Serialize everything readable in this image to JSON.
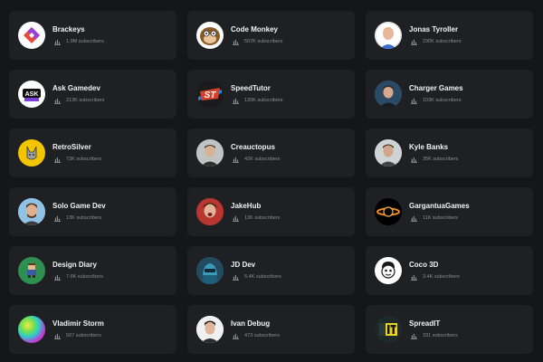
{
  "channels": [
    {
      "name": "Brackeys",
      "subs": "1.9M subscribers",
      "icon": "brackeys-logo-icon",
      "color": "#ffffff"
    },
    {
      "name": "Code Monkey",
      "subs": "597K subscribers",
      "icon": "monkey-avatar-icon",
      "color": "#ffffff"
    },
    {
      "name": "Jonas Tyroller",
      "subs": "230K subscribers",
      "icon": "person-avatar-icon",
      "color": "#ffffff"
    },
    {
      "name": "Ask Gamedev",
      "subs": "213K subscribers",
      "icon": "ask-gamedev-logo-icon",
      "color": "#ffffff"
    },
    {
      "name": "SpeedTutor",
      "subs": "130K subscribers",
      "icon": "speedtutor-logo-icon",
      "color": "#1b1b1b"
    },
    {
      "name": "Charger Games",
      "subs": "103K subscribers",
      "icon": "person-avatar-icon",
      "color": "#3a5a7a"
    },
    {
      "name": "RetroSilver",
      "subs": "73K subscribers",
      "icon": "retrosilver-logo-icon",
      "color": "#f2c500"
    },
    {
      "name": "Creauctopus",
      "subs": "42K subscribers",
      "icon": "person-avatar-icon",
      "color": "#cfcfcf"
    },
    {
      "name": "Kyle Banks",
      "subs": "35K subscribers",
      "icon": "person-avatar-icon",
      "color": "#d8d8d8"
    },
    {
      "name": "Solo Game Dev",
      "subs": "13K subscribers",
      "icon": "person-avatar-icon",
      "color": "#7fb4d9"
    },
    {
      "name": "JakeHub",
      "subs": "13K subscribers",
      "icon": "person-avatar-icon",
      "color": "#c2403a"
    },
    {
      "name": "GargantuaGames",
      "subs": "11K subscribers",
      "icon": "black-hole-logo-icon",
      "color": "#000000"
    },
    {
      "name": "Design Diary",
      "subs": "7.6K subscribers",
      "icon": "pixel-character-icon",
      "color": "#2f8f4e"
    },
    {
      "name": "JD Dev",
      "subs": "5.4K subscribers",
      "icon": "robot-avatar-icon",
      "color": "#2b6f8a"
    },
    {
      "name": "Coco 3D",
      "subs": "3.4K subscribers",
      "icon": "cartoon-face-icon",
      "color": "#ffffff"
    },
    {
      "name": "Vladimir Storm",
      "subs": "507 subscribers",
      "icon": "gradient-orb-icon",
      "color": "#c23ad8"
    },
    {
      "name": "Ivan Debug",
      "subs": "473 subscribers",
      "icon": "person-avatar-icon",
      "color": "#f3f3f3"
    },
    {
      "name": "SpreadIT",
      "subs": "331 subscribers",
      "icon": "spreadit-logo-icon",
      "color": "#1d2a2a"
    }
  ]
}
